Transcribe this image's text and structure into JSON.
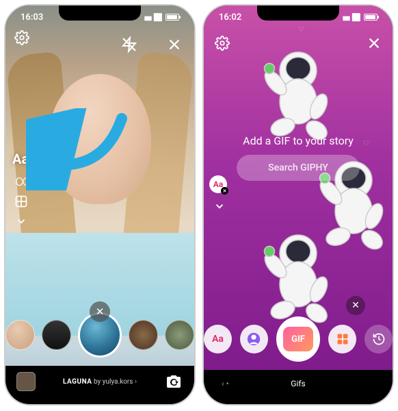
{
  "left": {
    "time": "16:03",
    "rail": {
      "settings": "gear-icon",
      "flash": "flash-off-icon",
      "close": "close-icon",
      "text_tool": "Aa",
      "boomerang": "∞",
      "layout": "layout-icon",
      "expand": "chevron-down-icon"
    },
    "close_carousel": "✕",
    "filter": {
      "name": "LAGUNA",
      "by_prefix": "by",
      "author": "yulya.kors"
    },
    "lenses": [
      "face-1",
      "speaker",
      "laguna-selected",
      "portrait-1",
      "portrait-2"
    ],
    "gallery": "gallery-thumbnail",
    "camswap": "flip-camera-icon",
    "annotation_arrow": "points-to-text-tool"
  },
  "right": {
    "time": "16:02",
    "title": "Add a GIF to your story",
    "search_placeholder": "Search GIPHY",
    "rail": {
      "settings": "gear-icon",
      "close": "close-icon",
      "badge": "Aa",
      "expand": "chevron-down-icon"
    },
    "close_preview": "✕",
    "modes": {
      "aa": "Aa",
      "avatar": "avatar-icon",
      "gif": "GIF",
      "templates": "grid-icon",
      "history": "history-icon"
    },
    "mode_label": "Gifs",
    "sticker": "astronaut-waving"
  }
}
